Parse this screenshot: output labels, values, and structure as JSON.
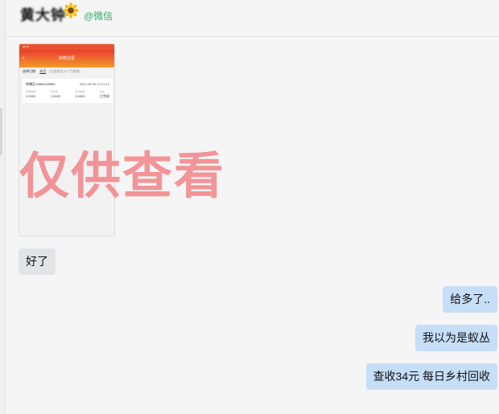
{
  "header": {
    "contact_name": "黄大钟",
    "contact_icon": "sunflower-icon",
    "source_tag": "@微信"
  },
  "shared_screenshot": {
    "status_time": "10:39",
    "title": "转赠记录",
    "filter_label": "选择日期:",
    "filter_value": "本月",
    "filter_hint": "(仅查看近31个月数据)",
    "account": "转赠至13804133990",
    "time": "2022-06-09 12:21:12",
    "columns": [
      {
        "label": "转赠数量",
        "value": "3.0000"
      },
      {
        "label": "手续费",
        "value": "1.0000"
      },
      {
        "label": "实际到账",
        "value": "3.0000"
      },
      {
        "label": "状态",
        "value": "已完成"
      }
    ]
  },
  "watermark": "仅供查看",
  "messages": [
    {
      "side": "received",
      "text": "好了"
    },
    {
      "side": "sent",
      "text": "给多了.."
    },
    {
      "side": "sent",
      "text": "我以为是蚁丛"
    },
    {
      "side": "sent",
      "text": "查收34元   每日乡村回收"
    }
  ],
  "colors": {
    "received_bubble": "#e3e4e7",
    "sent_bubble": "#c6def8",
    "source_tag": "#2aae67",
    "watermark": "#f2787e"
  }
}
